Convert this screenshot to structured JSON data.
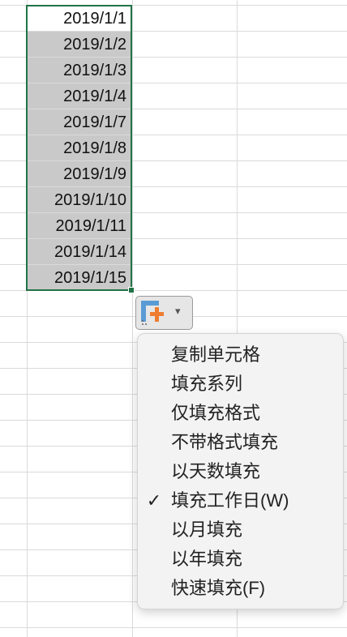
{
  "cells": [
    {
      "value": "2019/1/1"
    },
    {
      "value": "2019/1/2"
    },
    {
      "value": "2019/1/3"
    },
    {
      "value": "2019/1/4"
    },
    {
      "value": "2019/1/7"
    },
    {
      "value": "2019/1/8"
    },
    {
      "value": "2019/1/9"
    },
    {
      "value": "2019/1/10"
    },
    {
      "value": "2019/1/11"
    },
    {
      "value": "2019/1/14"
    },
    {
      "value": "2019/1/15"
    }
  ],
  "autofill_options": {
    "icon": "autofill-options-icon",
    "caret": "▾",
    "menu_items": [
      {
        "label": "复制单元格",
        "checked": false
      },
      {
        "label": "填充系列",
        "checked": false
      },
      {
        "label": "仅填充格式",
        "checked": false
      },
      {
        "label": "不带格式填充",
        "checked": false
      },
      {
        "label": "以天数填充",
        "checked": false
      },
      {
        "label": "填充工作日(W)",
        "checked": true
      },
      {
        "label": "以月填充",
        "checked": false
      },
      {
        "label": "以年填充",
        "checked": false
      },
      {
        "label": "快速填充(F)",
        "checked": false
      }
    ],
    "check_mark": "✓"
  },
  "colors": {
    "selection_border": "#217346",
    "selected_fill": "#c9c9c9",
    "menu_bg": "#f3f3f3"
  }
}
